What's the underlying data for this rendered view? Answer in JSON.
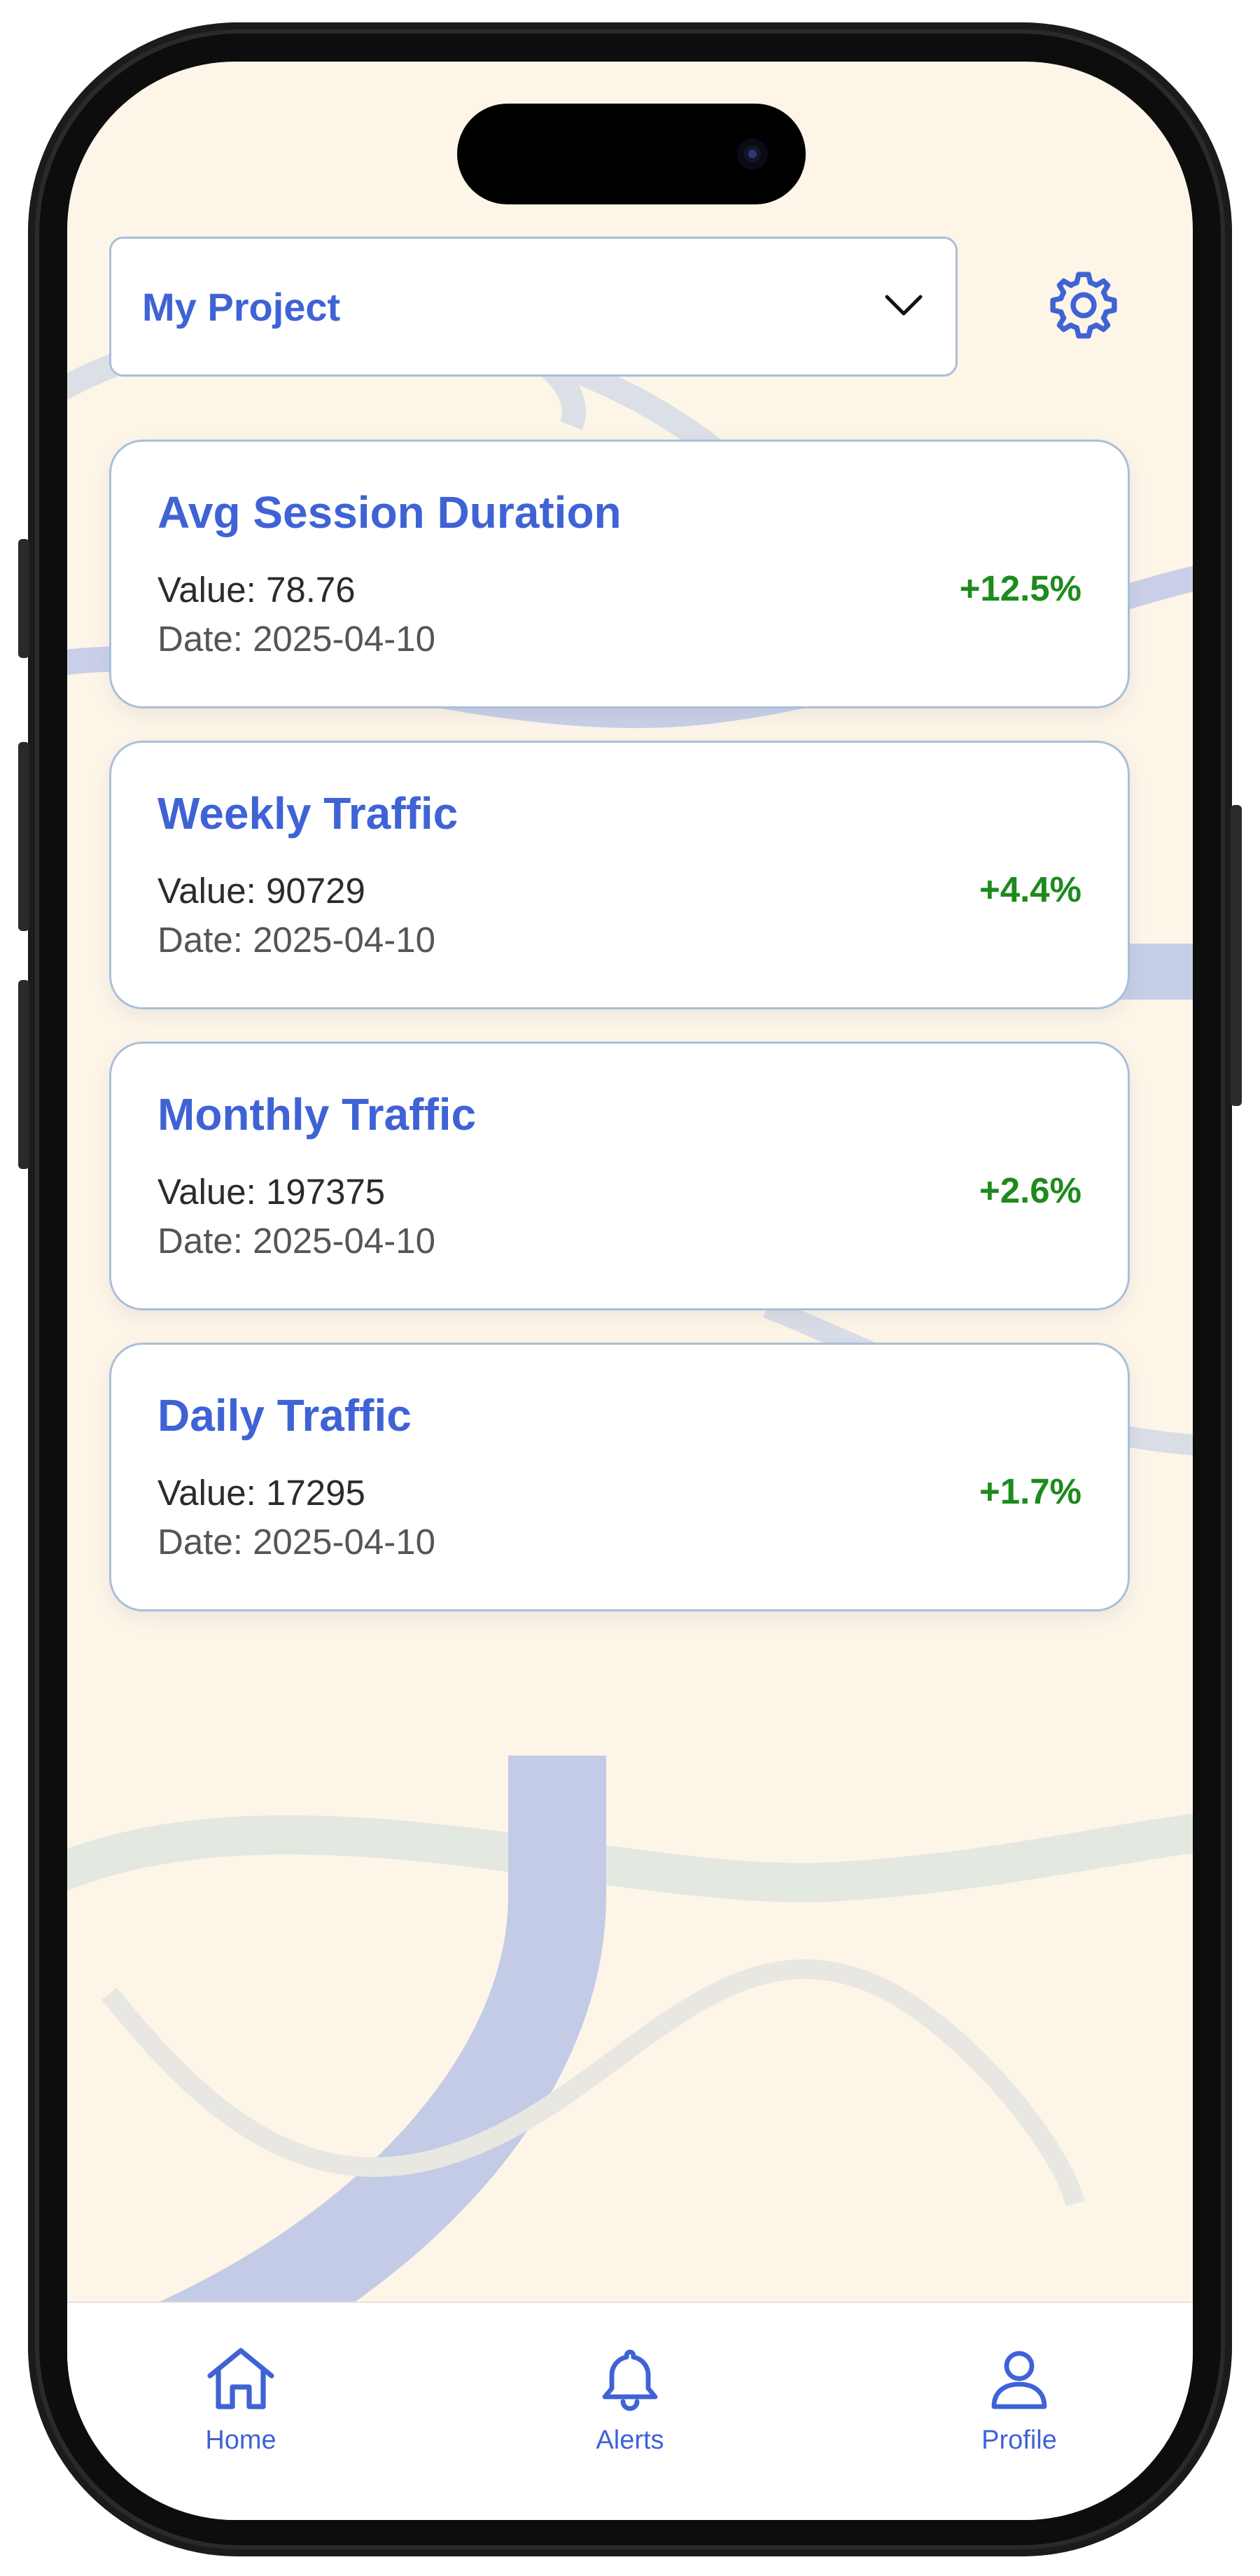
{
  "header": {
    "project_selector": {
      "selected": "My Project"
    }
  },
  "metrics": [
    {
      "title": "Avg Session Duration",
      "value": "Value: 78.76",
      "date": "Date: 2025-04-10",
      "change": "+12.5%"
    },
    {
      "title": "Weekly Traffic",
      "value": "Value: 90729",
      "date": "Date: 2025-04-10",
      "change": "+4.4%"
    },
    {
      "title": "Monthly Traffic",
      "value": "Value: 197375",
      "date": "Date: 2025-04-10",
      "change": "+2.6%"
    },
    {
      "title": "Daily Traffic",
      "value": "Value: 17295",
      "date": "Date: 2025-04-10",
      "change": "+1.7%"
    }
  ],
  "tabbar": {
    "home": {
      "label": "Home",
      "icon": "home-icon"
    },
    "alerts": {
      "label": "Alerts",
      "icon": "bell-icon"
    },
    "profile": {
      "label": "Profile",
      "icon": "user-icon"
    }
  },
  "colors": {
    "accent": "#3f63d5",
    "positive": "#1d8a1d",
    "background": "#fdf5e8",
    "card_border": "#a9bfd9"
  }
}
